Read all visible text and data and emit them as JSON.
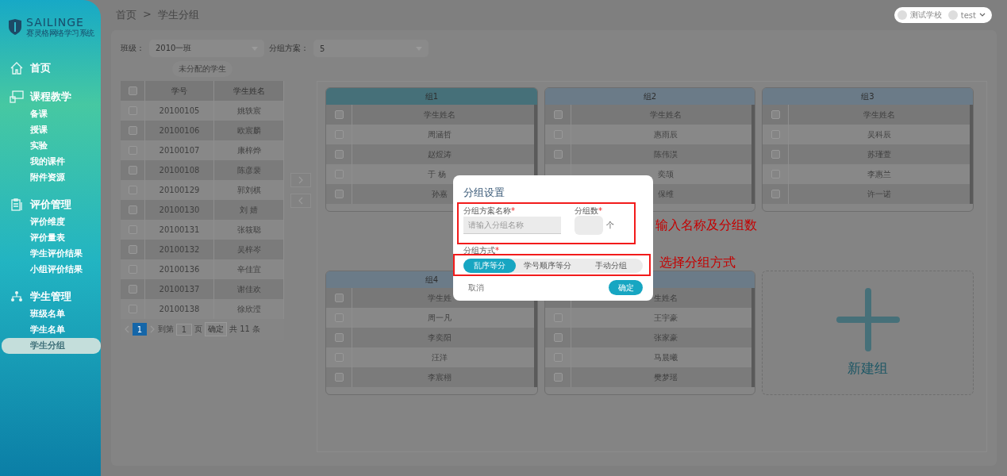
{
  "sidebar": {
    "logo": {
      "name": "SAILINGE",
      "subtitle": "赛灵格网络学习系统"
    },
    "menu": [
      {
        "label": "首页",
        "kind": "home"
      },
      {
        "label": "课程教学",
        "kind": "course",
        "children": [
          {
            "label": "备课",
            "selected": false
          },
          {
            "label": "授课",
            "selected": false
          },
          {
            "label": "实验",
            "selected": false
          },
          {
            "label": "我的课件",
            "selected": false
          },
          {
            "label": "附件资源",
            "selected": false
          }
        ]
      },
      {
        "label": "评价管理",
        "kind": "evaluation",
        "children": [
          {
            "label": "评价维度",
            "selected": false
          },
          {
            "label": "评价量表",
            "selected": false
          },
          {
            "label": "学生评价结果",
            "selected": false
          },
          {
            "label": "小组评价结果",
            "selected": false
          }
        ]
      },
      {
        "label": "学生管理",
        "kind": "students",
        "children": [
          {
            "label": "班级名单",
            "selected": false
          },
          {
            "label": "学生名单",
            "selected": false
          },
          {
            "label": "学生分组",
            "selected": true
          }
        ]
      }
    ]
  },
  "breadcrumb": [
    "首页",
    ">",
    "学生分组"
  ],
  "user_bar": {
    "school": "测试学校",
    "user": "test"
  },
  "filters": [
    {
      "label": "班级：",
      "value": "2010一班"
    },
    {
      "label": "分组方案：",
      "value": "5"
    }
  ],
  "unassigned": {
    "title": "未分配的学生",
    "header_checked": false,
    "columns": [
      "学号",
      "学生姓名"
    ],
    "rows": [
      {
        "id": "20100105",
        "name": "姚轶宸",
        "checked": false
      },
      {
        "id": "20100106",
        "name": "欧宸麟",
        "checked": false
      },
      {
        "id": "20100107",
        "name": "康梓烨",
        "checked": false
      },
      {
        "id": "20100108",
        "name": "陈彦裴",
        "checked": false
      },
      {
        "id": "20100129",
        "name": "郭刘棋",
        "checked": false
      },
      {
        "id": "20100130",
        "name": "刘 婧",
        "checked": false
      },
      {
        "id": "20100131",
        "name": "张筱聪",
        "checked": false
      },
      {
        "id": "20100132",
        "name": "吴梓岑",
        "checked": false
      },
      {
        "id": "20100136",
        "name": "辛佳宜",
        "checked": false
      },
      {
        "id": "20100137",
        "name": "谢佳欢",
        "checked": false
      },
      {
        "id": "20100138",
        "name": "徐欣滢",
        "checked": false
      }
    ],
    "pagination": {
      "pages": [
        {
          "label": "1",
          "selected": true
        }
      ],
      "goto_label": "到第",
      "goto_value": "1",
      "page_unit": "页",
      "confirm": "确定",
      "total": "共 11 条"
    }
  },
  "groups": [
    {
      "title": "组1",
      "header": {
        "text": "学生姓名",
        "checked": false
      },
      "members": [
        {
          "name": "周涵哲",
          "checked": false
        },
        {
          "name": "赵煜涛",
          "checked": false
        },
        {
          "name": "于 杨",
          "checked": false
        },
        {
          "name": "孙嘉",
          "checked": false
        }
      ]
    },
    {
      "title": "组2",
      "header": {
        "text": "学生姓名",
        "checked": false
      },
      "members": [
        {
          "name": "惠雨辰",
          "checked": false
        },
        {
          "name": "陈伟淏",
          "checked": false
        },
        {
          "name": "奕颉"
        },
        {
          "name": "保维"
        }
      ]
    },
    {
      "title": "组3",
      "header": {
        "text": "学生姓名",
        "checked": false
      },
      "members": [
        {
          "name": "吴科辰",
          "checked": false
        },
        {
          "name": "苏瑾萱",
          "checked": false
        },
        {
          "name": "李惠兰",
          "checked": false
        },
        {
          "name": "许一诺",
          "checked": false
        }
      ]
    },
    {
      "title": "组4",
      "header": {
        "text": "学生姓",
        "checked": false
      },
      "members": [
        {
          "name": "周一凡",
          "checked": false
        },
        {
          "name": "李奕阳",
          "checked": false
        },
        {
          "name": "汪洋",
          "checked": false
        },
        {
          "name": "李宸栩",
          "checked": false
        }
      ]
    },
    {
      "header": {
        "text": "生姓名"
      },
      "members": [
        {
          "name": "王宇豪",
          "checked": false
        },
        {
          "name": "张家豪",
          "checked": false
        },
        {
          "name": "马晨曦",
          "checked": false
        },
        {
          "name": "樊梦瑶",
          "checked": false
        }
      ]
    }
  ],
  "new_group": {
    "label": "新建组"
  },
  "dialog": {
    "title": "分组设置",
    "fields": [
      {
        "label": "分组方案名称",
        "mark": "*",
        "placeholder": "请输入分组名称"
      },
      {
        "label": "分组数",
        "mark": "*",
        "unit": "个"
      }
    ],
    "mode_label": "分组方式",
    "mode_mark": "*",
    "modes": [
      {
        "label": "乱序等分",
        "selected": true
      },
      {
        "label": "学号顺序等分",
        "selected": false
      },
      {
        "label": "手动分组",
        "selected": false
      }
    ],
    "cancel": "取消",
    "confirm": "确定"
  },
  "annotations": [
    "输入名称及分组数",
    "选择分组方式"
  ]
}
